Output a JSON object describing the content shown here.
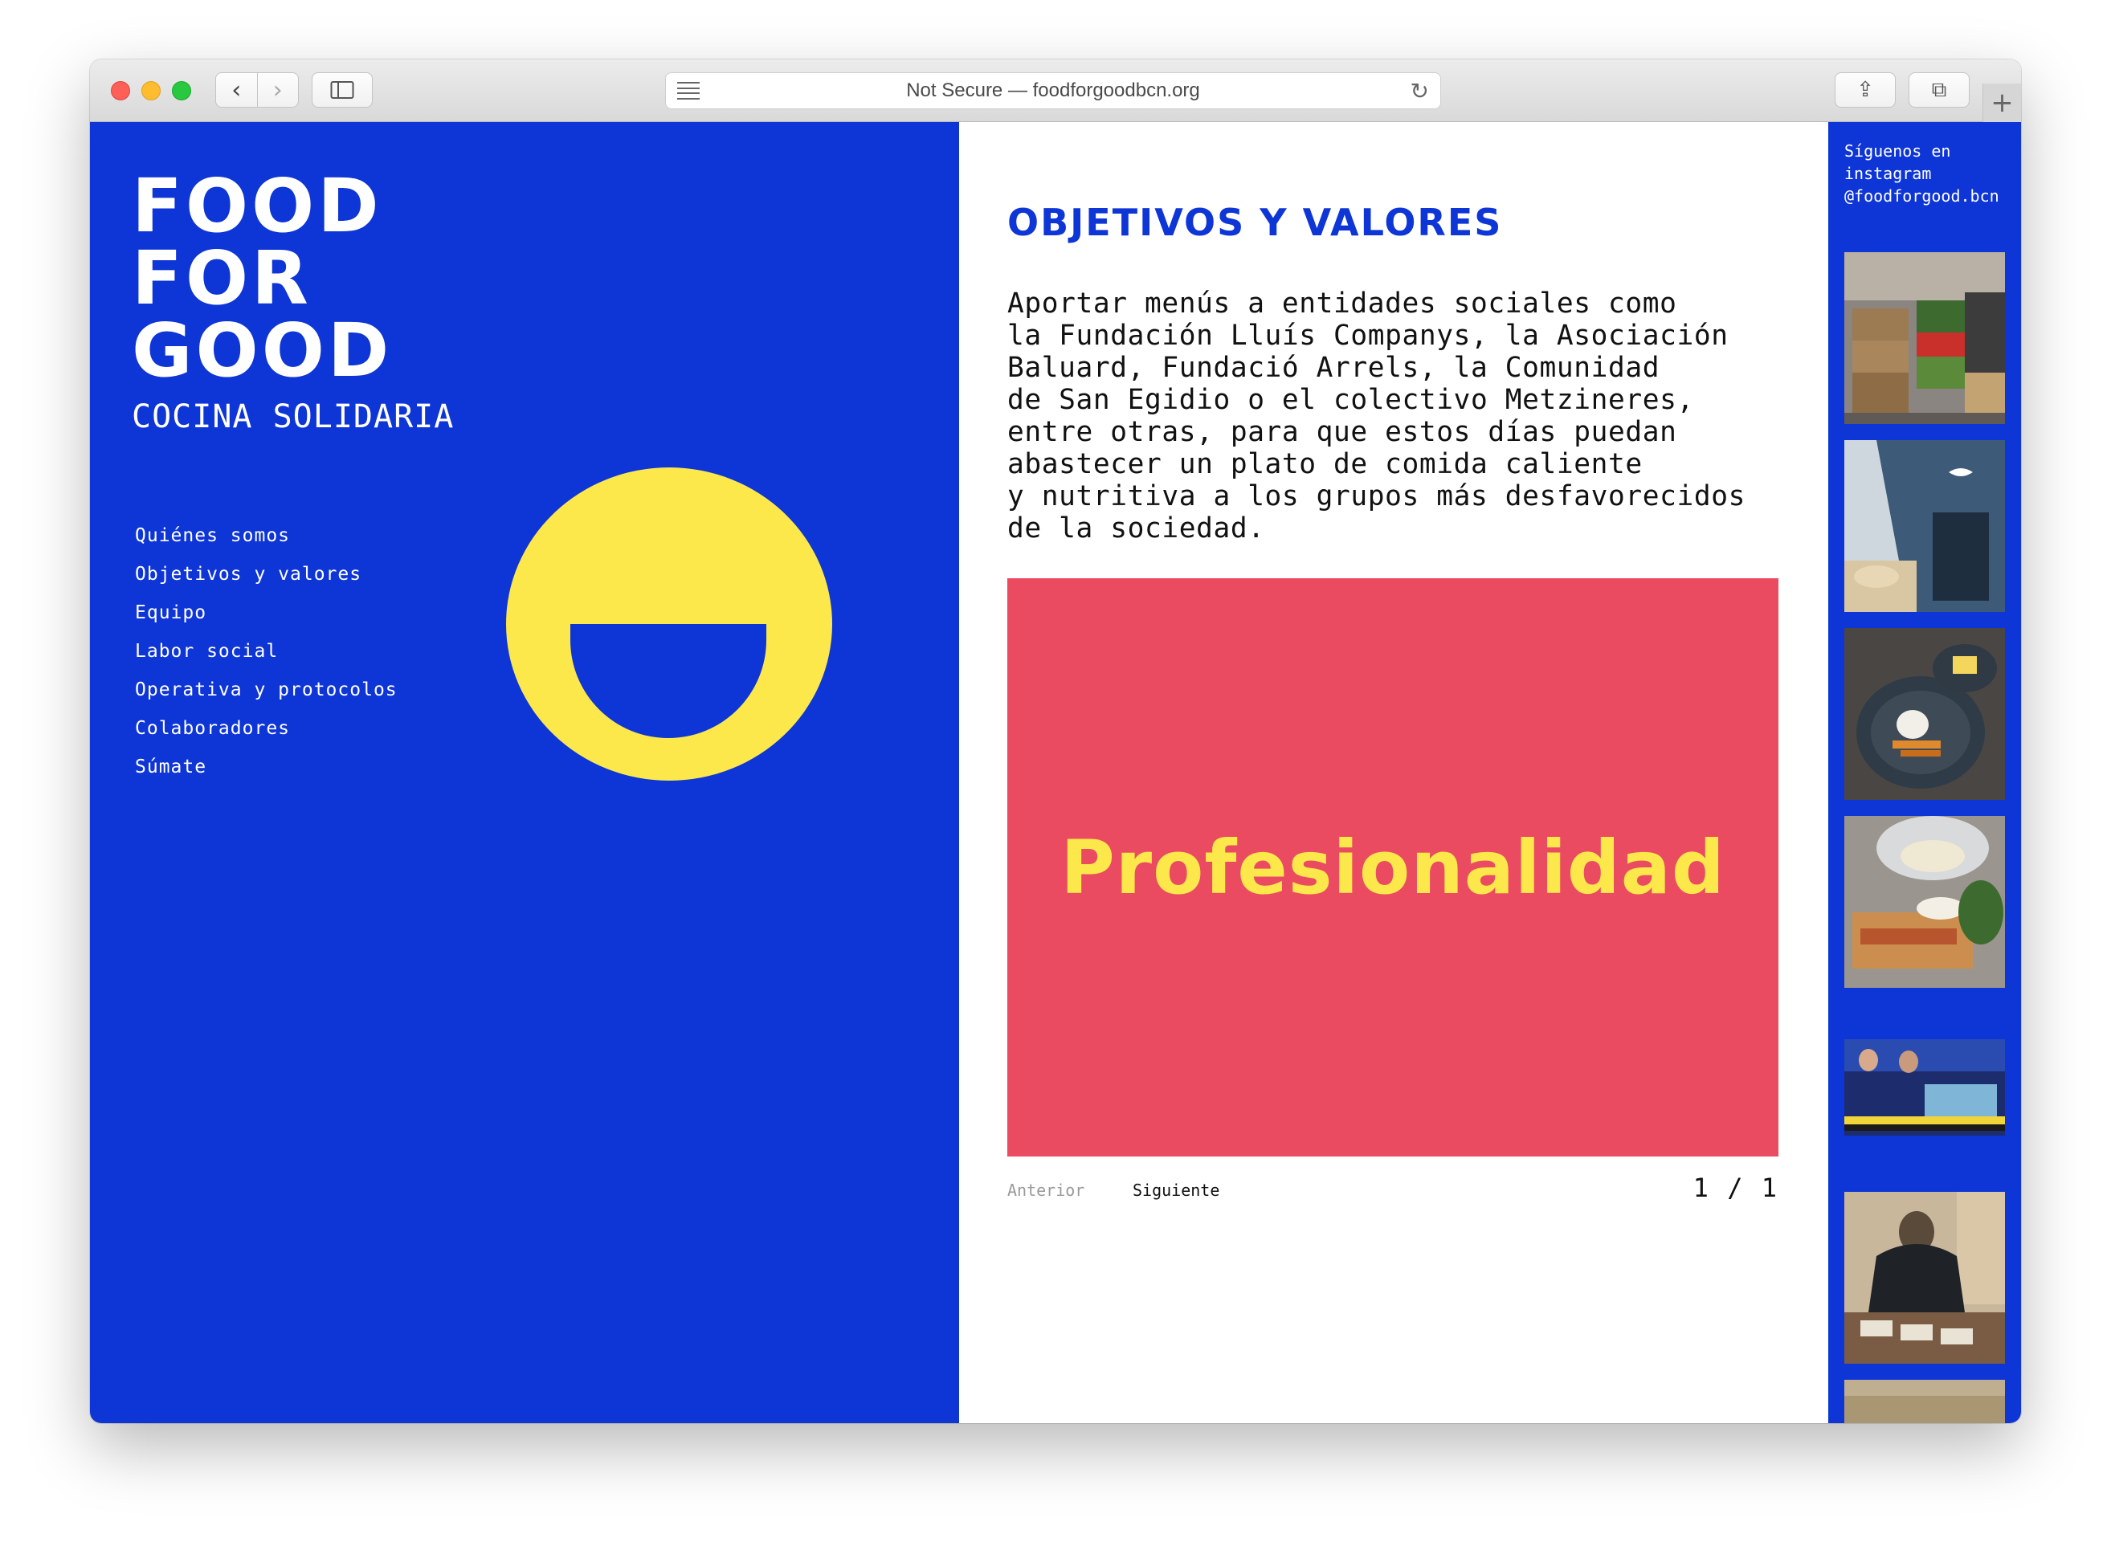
{
  "browser": {
    "address": "Not Secure — foodforgoodbcn.org",
    "back_glyph": "‹",
    "forward_glyph": "›",
    "reload_glyph": "↻",
    "share_glyph": "⇪",
    "tabs_glyph": "⧉",
    "new_tab_glyph": "+"
  },
  "brand": {
    "logo_lines": [
      "FOOD",
      "FOR",
      "GOOD"
    ],
    "subtitle": "COCINA SOLIDARIA"
  },
  "menu": [
    {
      "label": "Quiénes somos"
    },
    {
      "label": "Objetivos y valores"
    },
    {
      "label": "Equipo"
    },
    {
      "label": "Labor social"
    },
    {
      "label": "Operativa y protocolos"
    },
    {
      "label": "Colaboradores"
    },
    {
      "label": "Súmate"
    }
  ],
  "content": {
    "title": "OBJETIVOS Y VALORES",
    "body": "Aportar menús a entidades sociales como\nla Fundación Lluís Companys, la Asociación\nBaluard, Fundació Arrels, la Comunidad\nde San Egidio o el colectivo Metzineres,\nentre otras, para que estos días puedan\nabastecer un plato de comida caliente\ny nutritiva a los grupos más desfavorecidos\nde la sociedad.",
    "slide_word": "Profesionalidad",
    "prev_label": "Anterior",
    "next_label": "Siguiente",
    "counter": "1 / 1"
  },
  "instagram": {
    "line1": "Síguenos en",
    "line2": "instagram",
    "handle": "@foodforgood.bcn"
  },
  "colors": {
    "brand_blue": "#0e35d6",
    "accent_yellow": "#fde84c",
    "slide_red": "#ea4b61"
  }
}
